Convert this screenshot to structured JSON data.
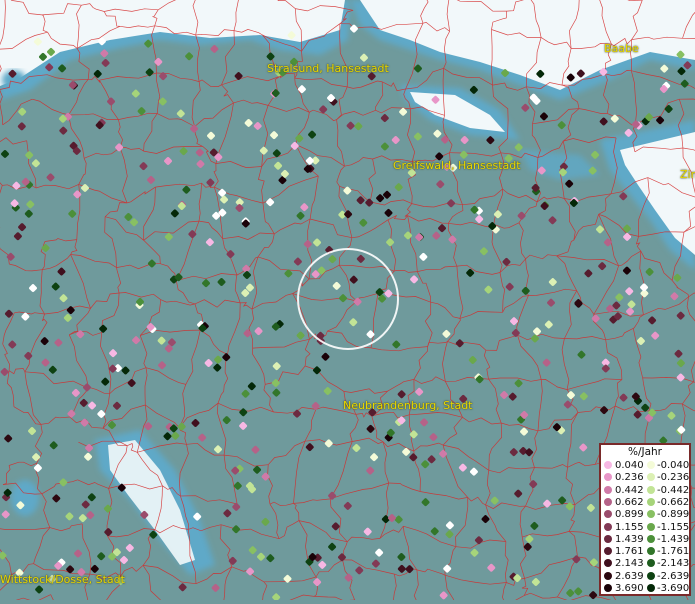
{
  "map": {
    "places": [
      {
        "name": "Stralsund, Hansestadt",
        "id": "stralsund"
      },
      {
        "name": "Greifswald, Hansestadt",
        "id": "greifswald"
      },
      {
        "name": "Baabe",
        "id": "baabe"
      },
      {
        "name": "Zin",
        "id": "zin"
      },
      {
        "name": "Neubrandenburg, Stadt",
        "id": "neubrandenburg"
      },
      {
        "name": "Wittstock/Dosse, Stadt",
        "id": "wittstock"
      }
    ],
    "colors": {
      "water": "#f2f8fa",
      "land": "#6f9a9c",
      "boundaries": "#d42a2a",
      "label": "#e8d800"
    }
  },
  "legend": {
    "title": "%/Jahr",
    "positive": [
      {
        "label": "0.040",
        "color": "#f7b8e4"
      },
      {
        "label": "0.236",
        "color": "#e896c8"
      },
      {
        "label": "0.442",
        "color": "#d07aa8"
      },
      {
        "label": "0.662",
        "color": "#b56288"
      },
      {
        "label": "0.899",
        "color": "#9a4c6c"
      },
      {
        "label": "1.155",
        "color": "#833a56"
      },
      {
        "label": "1.439",
        "color": "#6c2a40"
      },
      {
        "label": "1.761",
        "color": "#561c2e"
      },
      {
        "label": "2.143",
        "color": "#40101e"
      },
      {
        "label": "2.639",
        "color": "#2c0810"
      },
      {
        "label": "3.690",
        "color": "#1a0208"
      }
    ],
    "negative": [
      {
        "label": "-0.040",
        "color": "#f4fbd8"
      },
      {
        "label": "-0.236",
        "color": "#dcf0b4"
      },
      {
        "label": "-0.442",
        "color": "#c2e496"
      },
      {
        "label": "-0.662",
        "color": "#a6d47a"
      },
      {
        "label": "-0.899",
        "color": "#88c062"
      },
      {
        "label": "-1.155",
        "color": "#6aa84c"
      },
      {
        "label": "-1.439",
        "color": "#4c903a"
      },
      {
        "label": "-1.761",
        "color": "#32762a"
      },
      {
        "label": "-2.143",
        "color": "#1e5c1e"
      },
      {
        "label": "-2.639",
        "color": "#0e4212"
      },
      {
        "label": "-3.690",
        "color": "#042808"
      }
    ]
  }
}
